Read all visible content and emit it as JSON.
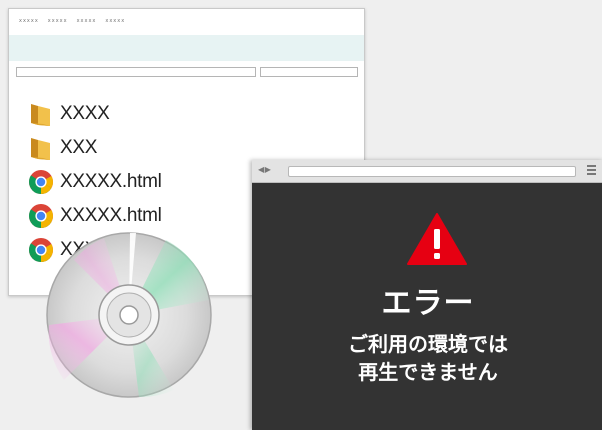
{
  "explorer": {
    "menu": [
      "xxxxx",
      "xxxxx",
      "xxxxx",
      "xxxxx"
    ],
    "files": [
      {
        "name": "XXXX",
        "icon": "folder-icon"
      },
      {
        "name": "XXX",
        "icon": "folder-icon"
      },
      {
        "name": "XXXXX.html",
        "icon": "chrome-icon"
      },
      {
        "name": "XXXXX.html",
        "icon": "chrome-icon"
      },
      {
        "name": "XXXXX.html",
        "icon": "chrome-icon"
      }
    ],
    "band_color": "#e7f3f3"
  },
  "browser": {
    "background_color": "#333333",
    "warning_color": "#e60012",
    "error_title": "エラー",
    "error_line1": "ご利用の環境では",
    "error_line2": "再生できません"
  }
}
